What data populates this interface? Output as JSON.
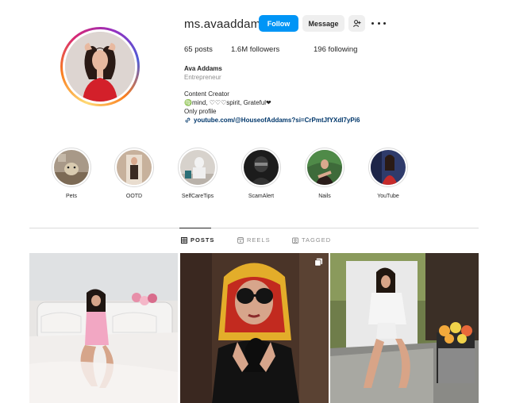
{
  "profile": {
    "username": "ms.avaaddams",
    "follow_label": "Follow",
    "message_label": "Message",
    "suggest_icon": "person-add-icon",
    "more_icon": "more-horizontal-icon"
  },
  "stats": {
    "posts_count": "65",
    "posts_label": " posts",
    "followers_count": "1.6M",
    "followers_label": " followers",
    "following_count": "196",
    "following_label": " following"
  },
  "bio": {
    "name": "Ava Addams",
    "category": "Entrepreneur",
    "line1": "Content Creator",
    "line2": "♍mind, ♡♡♡spirit, Grateful❤",
    "line3": "Only profile",
    "link": "youtube.com/@HouseofAddams?si=CrPmtJfYXdI7yPi6"
  },
  "highlights": [
    {
      "label": "Pets"
    },
    {
      "label": "OOTD"
    },
    {
      "label": "SelfCareTips"
    },
    {
      "label": "ScamAlert"
    },
    {
      "label": "Nails"
    },
    {
      "label": "YouTube"
    }
  ],
  "tabs": [
    {
      "label": "POSTS",
      "icon": "grid-icon",
      "active": true
    },
    {
      "label": "REELS",
      "icon": "reels-icon",
      "active": false
    },
    {
      "label": "TAGGED",
      "icon": "tagged-icon",
      "active": false
    }
  ],
  "colors": {
    "follow_blue": "#0095f6",
    "link_blue": "#00376b"
  }
}
